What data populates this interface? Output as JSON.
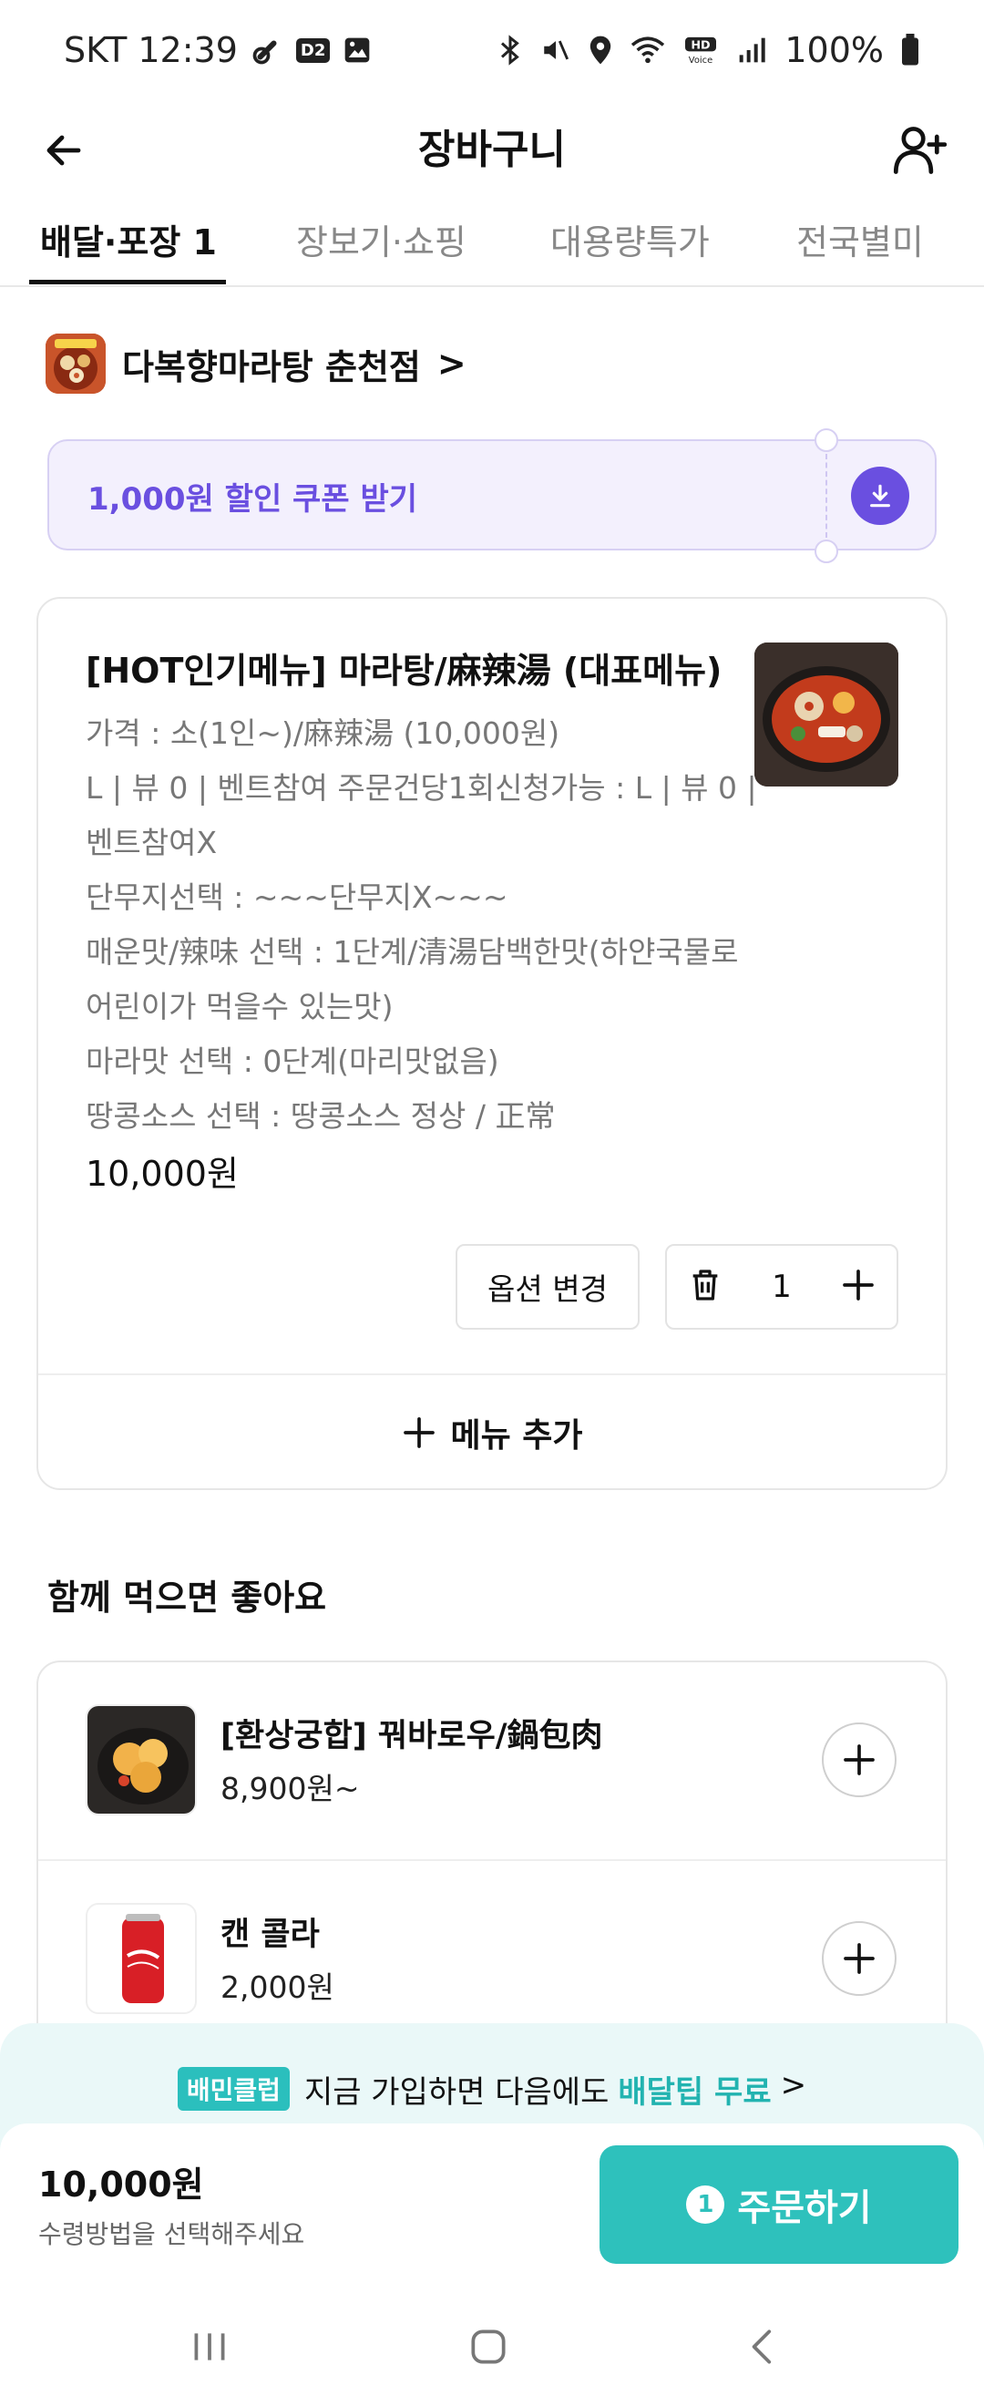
{
  "status_bar": {
    "carrier_time": "SKT 12:39",
    "d2_badge": "D2",
    "battery": "100%"
  },
  "header": {
    "title": "장바구니"
  },
  "tabs": [
    {
      "label": "배달·포장 1",
      "active": true
    },
    {
      "label": "장보기·쇼핑",
      "active": false
    },
    {
      "label": "대용량특가",
      "active": false
    },
    {
      "label": "전국별미",
      "active": false
    }
  ],
  "store": {
    "name": "다복향마라탕 춘천점",
    "chevron": ">"
  },
  "coupon": {
    "label": "1,000원 할인 쿠폰 받기",
    "accent_color": "#6a4fe0"
  },
  "cart_item": {
    "title": "[HOT인기메뉴] 마라탕/麻辣湯 (대표메뉴)",
    "options": [
      "가격 : 소(1인~)/麻辣湯 (10,000원)",
      "L | 뷰 0 | 벤트참여 주문건당1회신청가능 : L | 뷰 0 | 벤트참여X",
      "단무지선택 : ~~~단무지X~~~",
      "매운맛/辣味 선택 : 1단계/清湯담백한맛(하얀국물로 어린이가 먹을수 있는맛)",
      "마라맛 선택 : 0단계(마리맛없음)",
      "땅콩소스 선택 : 땅콩소스 정상 / 正常"
    ],
    "price": "10,000원",
    "option_change_label": "옵션 변경",
    "quantity": "1",
    "add_menu_label": "메뉴 추가"
  },
  "recommend": {
    "title": "함께 먹으면 좋아요",
    "items": [
      {
        "name": "[환상궁합] 꿔바로우/鍋包肉",
        "price": "8,900원~"
      },
      {
        "name": "캔 콜라",
        "price": "2,000원"
      }
    ]
  },
  "promo": {
    "badge": "배민클럽",
    "text": "지금 가입하면 다음에도",
    "highlight": "배달팁 무료",
    "chevron": ">"
  },
  "order_bar": {
    "total": "10,000원",
    "hint": "수령방법을 선택해주세요",
    "order_count": "1",
    "order_label": "주문하기",
    "brand_color": "#2ec1bc"
  }
}
